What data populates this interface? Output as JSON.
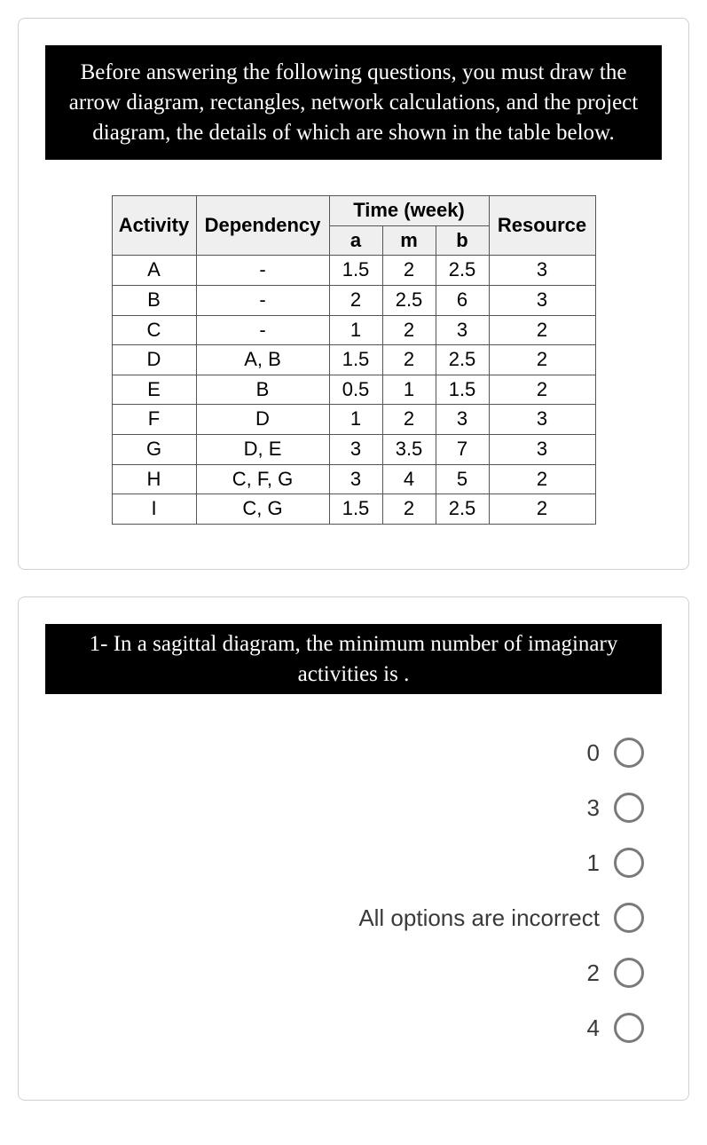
{
  "intro_banner": "Before answering the following questions, you must draw the arrow diagram, rectangles, network calculations, and the project diagram, the details of which are shown in the table below.",
  "table": {
    "headers": {
      "activity": "Activity",
      "dependency": "Dependency",
      "time_group": "Time (week)",
      "a": "a",
      "m": "m",
      "b": "b",
      "resource": "Resource"
    },
    "rows": [
      {
        "activity": "A",
        "dependency": "-",
        "a": "1.5",
        "m": "2",
        "b": "2.5",
        "resource": "3"
      },
      {
        "activity": "B",
        "dependency": "-",
        "a": "2",
        "m": "2.5",
        "b": "6",
        "resource": "3"
      },
      {
        "activity": "C",
        "dependency": "-",
        "a": "1",
        "m": "2",
        "b": "3",
        "resource": "2"
      },
      {
        "activity": "D",
        "dependency": "A, B",
        "a": "1.5",
        "m": "2",
        "b": "2.5",
        "resource": "2"
      },
      {
        "activity": "E",
        "dependency": "B",
        "a": "0.5",
        "m": "1",
        "b": "1.5",
        "resource": "2"
      },
      {
        "activity": "F",
        "dependency": "D",
        "a": "1",
        "m": "2",
        "b": "3",
        "resource": "3"
      },
      {
        "activity": "G",
        "dependency": "D, E",
        "a": "3",
        "m": "3.5",
        "b": "7",
        "resource": "3"
      },
      {
        "activity": "H",
        "dependency": "C, F, G",
        "a": "3",
        "m": "4",
        "b": "5",
        "resource": "2"
      },
      {
        "activity": "I",
        "dependency": "C, G",
        "a": "1.5",
        "m": "2",
        "b": "2.5",
        "resource": "2"
      }
    ]
  },
  "question_banner": "1- In a sagittal diagram, the minimum number of imaginary activities is .",
  "options": [
    "0",
    "3",
    "1",
    "All options are incorrect",
    "2",
    "4"
  ]
}
